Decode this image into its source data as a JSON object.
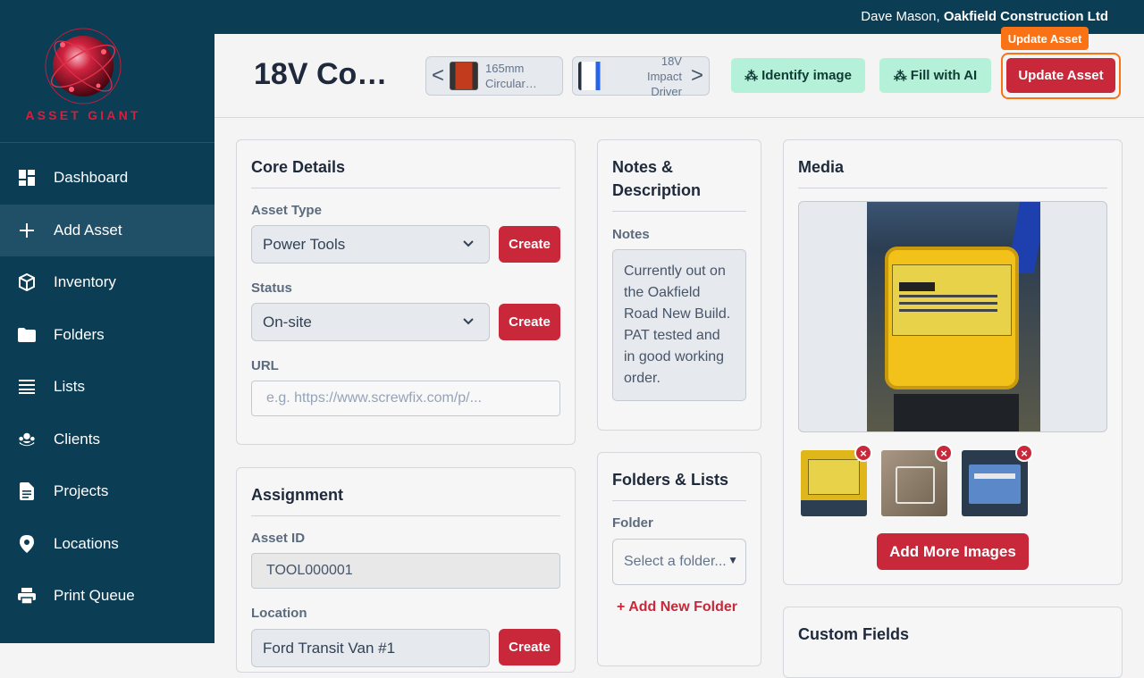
{
  "topbar": {
    "user_name": "Dave Mason,",
    "company": "Oakfield Construction Ltd"
  },
  "brand": {
    "logo_text": "ASSET GIANT",
    "accent": "#d81e3a",
    "sidebar_bg": "#0b3d55"
  },
  "sidebar": {
    "items": [
      {
        "label": "Dashboard",
        "icon": "dashboard-icon"
      },
      {
        "label": "Add Asset",
        "icon": "plus-icon"
      },
      {
        "label": "Inventory",
        "icon": "box-icon"
      },
      {
        "label": "Folders",
        "icon": "folder-icon"
      },
      {
        "label": "Lists",
        "icon": "list-icon"
      },
      {
        "label": "Clients",
        "icon": "clients-icon"
      },
      {
        "label": "Projects",
        "icon": "document-icon"
      },
      {
        "label": "Locations",
        "icon": "location-pin-icon"
      },
      {
        "label": "Print Queue",
        "icon": "printer-icon"
      }
    ],
    "active": "Add Asset"
  },
  "header": {
    "title": "18V Co…",
    "prev_asset": {
      "arrow": "<",
      "label": "165mm Circular…"
    },
    "next_asset": {
      "arrow": ">",
      "label": "18V Impact Driver"
    },
    "identify_label": "Identify image",
    "fill_ai_label": "Fill with AI",
    "update_label": "Update Asset",
    "tooltip": "Update Asset"
  },
  "core": {
    "heading": "Core Details",
    "asset_type_label": "Asset Type",
    "asset_type_value": "Power Tools",
    "status_label": "Status",
    "status_value": "On-site",
    "create_label": "Create",
    "url_label": "URL",
    "url_placeholder": "e.g. https://www.screwfix.com/p/..."
  },
  "assignment": {
    "heading": "Assignment",
    "asset_id_label": "Asset ID",
    "asset_id_value": "TOOL000001",
    "location_label": "Location",
    "location_value": "Ford Transit Van #1",
    "create_label": "Create"
  },
  "notes": {
    "heading": "Notes & Description",
    "notes_label": "Notes",
    "notes_value": "Currently out on the Oakfield Road New Build. PAT tested and in good working order."
  },
  "folders": {
    "heading": "Folders & Lists",
    "folder_label": "Folder",
    "folder_placeholder": "Select a folder...",
    "add_folder": "+ Add New Folder"
  },
  "media": {
    "heading": "Media",
    "add_more": "Add More Images",
    "remove_glyph": "×"
  },
  "custom_fields": {
    "heading": "Custom Fields"
  }
}
